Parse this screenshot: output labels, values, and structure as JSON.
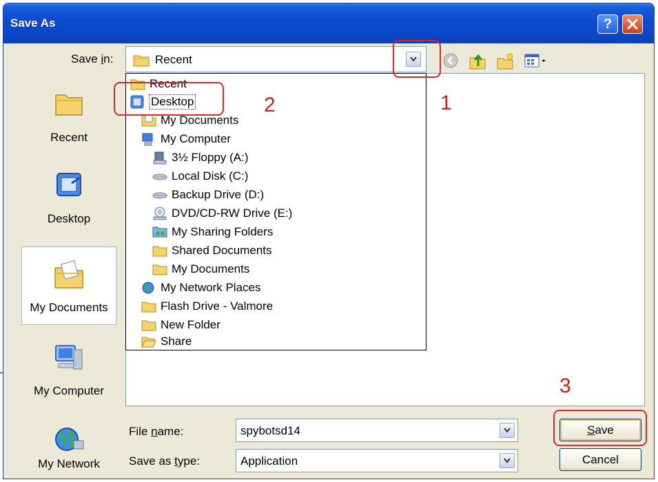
{
  "window": {
    "title": "Save As",
    "help_label": "?"
  },
  "save_in": {
    "label": "Save in:",
    "label_prefix": "Save ",
    "label_mnemonic": "i",
    "label_suffix": "n:",
    "value": "Recent"
  },
  "places": [
    {
      "label": "Recent",
      "icon": "recent-folder-icon"
    },
    {
      "label": "Desktop",
      "icon": "desktop-icon"
    },
    {
      "label": "My Documents",
      "icon": "my-documents-icon",
      "selected": true
    },
    {
      "label": "My Computer",
      "icon": "my-computer-icon"
    },
    {
      "label": "My Network",
      "icon": "my-network-icon"
    }
  ],
  "dropdown_items": [
    {
      "label": "Recent",
      "icon": "folder-icon",
      "indent": 0
    },
    {
      "label": "Desktop",
      "icon": "desktop-icon",
      "indent": 0,
      "highlighted": true
    },
    {
      "label": "My Documents",
      "icon": "my-documents-icon",
      "indent": 1
    },
    {
      "label": "My Computer",
      "icon": "my-computer-icon",
      "indent": 1
    },
    {
      "label": "3½ Floppy (A:)",
      "icon": "floppy-icon",
      "indent": 2
    },
    {
      "label": "Local Disk (C:)",
      "icon": "hard-disk-icon",
      "indent": 2
    },
    {
      "label": "Backup Drive (D:)",
      "icon": "hard-disk-icon",
      "indent": 2
    },
    {
      "label": "DVD/CD-RW Drive (E:)",
      "icon": "cd-drive-icon",
      "indent": 2
    },
    {
      "label": "My Sharing Folders",
      "icon": "shared-folder-icon",
      "indent": 2
    },
    {
      "label": "Shared Documents",
      "icon": "folder-icon",
      "indent": 2
    },
    {
      "label": "My Documents",
      "icon": "folder-icon",
      "indent": 2
    },
    {
      "label": "My Network Places",
      "icon": "network-icon",
      "indent": 1
    },
    {
      "label": "Flash Drive - Valmore",
      "icon": "folder-icon",
      "indent": 1
    },
    {
      "label": "New Folder",
      "icon": "folder-icon",
      "indent": 1
    },
    {
      "label": "Share",
      "icon": "open-folder-icon",
      "indent": 1
    }
  ],
  "file_name": {
    "label_prefix": "File ",
    "label_mnemonic": "n",
    "label_suffix": "ame:",
    "value": "spybotsd14"
  },
  "save_as_type": {
    "label_prefix": "Save as ",
    "label_mnemonic": "t",
    "label_suffix": "ype:",
    "value": "Application"
  },
  "buttons": {
    "save_mnemonic": "S",
    "save_rest": "ave",
    "cancel": "Cancel"
  },
  "annotations": [
    "1",
    "2",
    "3"
  ],
  "colors": {
    "annotation_red": "#d9262b",
    "titlebar_blue": "#0b4bd1",
    "dialog_bg": "#ece9d8"
  }
}
